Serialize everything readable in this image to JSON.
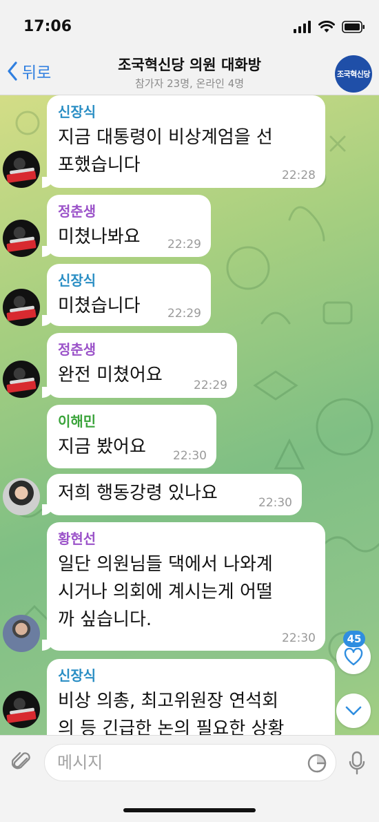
{
  "status": {
    "time": "17:06"
  },
  "header": {
    "back_label": "뒤로",
    "title": "조국혁신당 의원 대화방",
    "subtitle": "참가자 23명, 온라인 4명",
    "avatar_text": "조국혁신당"
  },
  "messages": [
    {
      "sender": "신장식",
      "sender_color": "#2a8ec4",
      "lines": [
        "지금 대통령이 비상계엄을 선",
        "포했습니다"
      ],
      "time": "22:28"
    },
    {
      "sender": "정춘생",
      "sender_color": "#9b53c9",
      "lines": [
        "미쳤나봐요"
      ],
      "time": "22:29"
    },
    {
      "sender": "신장식",
      "sender_color": "#2a8ec4",
      "lines": [
        "미쳤습니다"
      ],
      "time": "22:29"
    },
    {
      "sender": "정춘생",
      "sender_color": "#9b53c9",
      "lines": [
        "완전 미쳤어요"
      ],
      "time": "22:29"
    },
    {
      "sender": "이해민",
      "sender_color": "#3aa33a",
      "lines": [
        "지금 봤어요"
      ],
      "time": "22:30"
    },
    {
      "sender": "",
      "lines": [
        "저희 행동강령 있나요"
      ],
      "time": "22:30"
    },
    {
      "sender": "황현선",
      "sender_color": "#9b53c9",
      "lines": [
        "일단 의원님들 댁에서 나와계",
        "시거나 의회에 계시는게 어떨",
        "까 싶습니다."
      ],
      "time": "22:30"
    },
    {
      "sender": "신장식",
      "sender_color": "#2a8ec4",
      "lines": [
        "비상 의총, 최고위원장 연석회",
        "의 등 긴급한 논의 필요한 상황"
      ],
      "time": ""
    }
  ],
  "unread_count": "45",
  "input": {
    "placeholder": "메시지"
  }
}
